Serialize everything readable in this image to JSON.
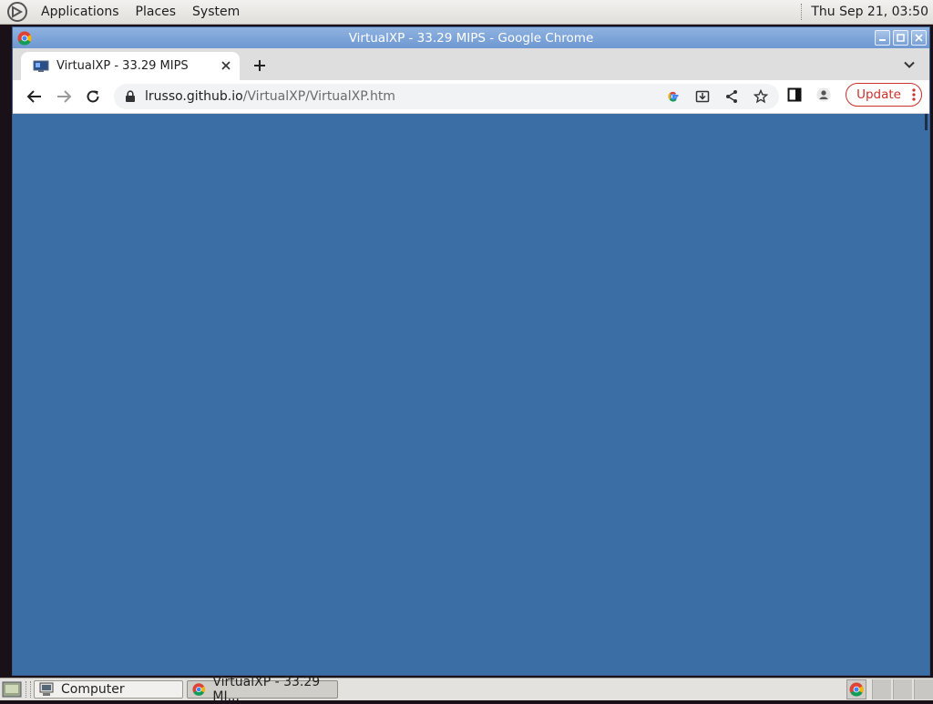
{
  "top_panel": {
    "menus": [
      "Applications",
      "Places",
      "System"
    ],
    "clock": "Thu Sep 21, 03:50"
  },
  "window": {
    "title": "VirtualXP - 33.29 MIPS - Google Chrome",
    "tab": {
      "title": "VirtualXP - 33.29 MIPS"
    },
    "url": {
      "host": "lrusso.github.io",
      "path": "/VirtualXP/VirtualXP.htm"
    },
    "update_label": "Update"
  },
  "page": {
    "background": "#3b6ea5"
  },
  "taskbar": {
    "tasks": [
      {
        "label": "Computer"
      },
      {
        "label": "VirtualXP - 33.29 MI..."
      }
    ]
  },
  "colors": {
    "accent_update": "#c9302c",
    "titlebar": "#7aa1d6"
  }
}
